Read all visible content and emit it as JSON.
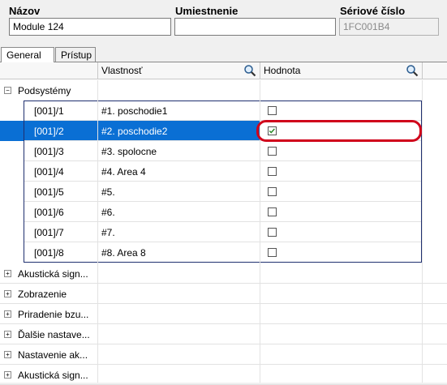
{
  "header": {
    "name_label": "Názov",
    "name_value": "Module 124",
    "location_label": "Umiestnenie",
    "location_value": "",
    "serial_label": "Sériové číslo",
    "serial_value": "1FC001B4"
  },
  "tabs": [
    {
      "label": "General",
      "active": true
    },
    {
      "label": "Prístup",
      "active": false
    }
  ],
  "grid": {
    "col_property": "Vlastnosť",
    "col_value": "Hodnota",
    "group": {
      "label": "Podsystémy",
      "expanded": true,
      "rows": [
        {
          "id": "[001]/1",
          "name": "#1. poschodie1",
          "checked": false,
          "selected": false
        },
        {
          "id": "[001]/2",
          "name": "#2. poschodie2",
          "checked": true,
          "selected": true
        },
        {
          "id": "[001]/3",
          "name": "#3. spolocne",
          "checked": false,
          "selected": false
        },
        {
          "id": "[001]/4",
          "name": "#4. Area 4",
          "checked": false,
          "selected": false
        },
        {
          "id": "[001]/5",
          "name": "#5.",
          "checked": false,
          "selected": false
        },
        {
          "id": "[001]/6",
          "name": "#6.",
          "checked": false,
          "selected": false
        },
        {
          "id": "[001]/7",
          "name": "#7.",
          "checked": false,
          "selected": false
        },
        {
          "id": "[001]/8",
          "name": "#8. Area 8",
          "checked": false,
          "selected": false
        }
      ]
    },
    "collapsed_groups": [
      "Akustická sign...",
      "Zobrazenie",
      "Priradenie bzu...",
      "Ďalšie nastave...",
      "Nastavenie ak...",
      "Akustická sign..."
    ]
  },
  "colors": {
    "selection": "#0a6fd4",
    "highlight_ring": "#d0021b",
    "checkmark": "#2a8a2a"
  }
}
